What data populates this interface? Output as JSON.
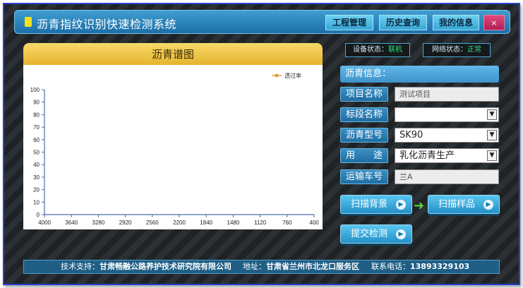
{
  "app": {
    "title": "沥青指纹识别快速检测系统"
  },
  "nav": {
    "project_mgmt": "工程管理",
    "history": "历史查询",
    "my_info": "我的信息",
    "close": "×"
  },
  "status": {
    "device_label": "设备状态：",
    "device_value": "联机",
    "network_label": "网络状态：",
    "network_value": "正常"
  },
  "chart_panel": {
    "title": "沥青谱图"
  },
  "chart_data": {
    "type": "line",
    "series": [
      {
        "name": "透过率",
        "x": [],
        "y": []
      }
    ],
    "x_ticks": [
      4000,
      3640,
      3280,
      2920,
      2560,
      2200,
      1840,
      1480,
      1120,
      760,
      400
    ],
    "y_ticks": [
      0,
      10,
      20,
      30,
      40,
      50,
      60,
      70,
      80,
      90,
      100
    ],
    "xlim": [
      4000,
      400
    ],
    "ylim": [
      0,
      100
    ],
    "legend_position": "top-right",
    "series_color": "#e0a030",
    "grid": false
  },
  "info": {
    "header": "沥青信息：",
    "project_name": {
      "label": "项目名称",
      "value": "测试项目"
    },
    "section_name": {
      "label": "标段名称",
      "value": ""
    },
    "asphalt_type": {
      "label": "沥青型号",
      "value": "SK90"
    },
    "usage": {
      "label": "用　　途",
      "value": "乳化沥青生产"
    },
    "vehicle_no": {
      "label": "运输车号",
      "value": "兰A"
    }
  },
  "actions": {
    "scan_background": "扫描背景",
    "scan_sample": "扫描样品",
    "submit": "提交检测"
  },
  "footer": {
    "support_label": "技术支持：",
    "support_value": "甘肃畅融公路养护技术研究院有限公司",
    "address_label": "地址：",
    "address_value": "甘肃省兰州市北龙口服务区",
    "phone_label": "联系电话：",
    "phone_value": "13893329103"
  },
  "icons": {
    "title_marker": "yellow-square-icon",
    "dropdown": "chevron-down-icon",
    "arrow": "circle-arrow-right-icon",
    "flow": "green-arrow-right-icon"
  },
  "colors": {
    "title_bar": "#2a86bf",
    "chart_header": "#f0c648",
    "status_ok": "#2fe07a",
    "close": "#c8306a"
  }
}
